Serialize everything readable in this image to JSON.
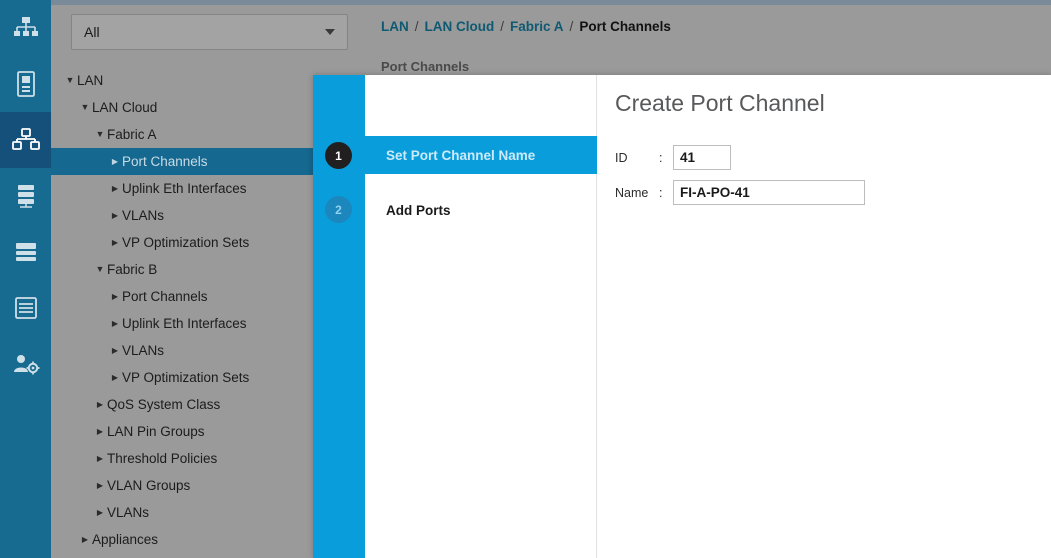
{
  "rail": {
    "items": [
      {
        "name": "equipment-icon",
        "label": "Equipment",
        "active": false
      },
      {
        "name": "servers-icon",
        "label": "Servers",
        "active": false
      },
      {
        "name": "lan-icon",
        "label": "LAN",
        "active": true
      },
      {
        "name": "san-icon",
        "label": "SAN",
        "active": false
      },
      {
        "name": "vm-icon",
        "label": "VM",
        "active": false
      },
      {
        "name": "storage-icon",
        "label": "Storage",
        "active": false
      },
      {
        "name": "admin-icon",
        "label": "Admin",
        "active": false
      }
    ]
  },
  "filter": {
    "value": "All",
    "placeholder": "All"
  },
  "tree": {
    "items": [
      {
        "label": "LAN",
        "indent": 0,
        "twisty": "caret-down",
        "selected": false
      },
      {
        "label": "LAN Cloud",
        "indent": 1,
        "twisty": "caret-down",
        "selected": false
      },
      {
        "label": "Fabric A",
        "indent": 2,
        "twisty": "caret-down",
        "selected": false
      },
      {
        "label": "Port Channels",
        "indent": 3,
        "twisty": "caret-right",
        "selected": true
      },
      {
        "label": "Uplink Eth Interfaces",
        "indent": 3,
        "twisty": "caret-right",
        "selected": false
      },
      {
        "label": "VLANs",
        "indent": 3,
        "twisty": "caret-right",
        "selected": false
      },
      {
        "label": "VP Optimization Sets",
        "indent": 3,
        "twisty": "caret-right",
        "selected": false
      },
      {
        "label": "Fabric B",
        "indent": 2,
        "twisty": "caret-down",
        "selected": false
      },
      {
        "label": "Port Channels",
        "indent": 3,
        "twisty": "caret-right",
        "selected": false
      },
      {
        "label": "Uplink Eth Interfaces",
        "indent": 3,
        "twisty": "caret-right",
        "selected": false
      },
      {
        "label": "VLANs",
        "indent": 3,
        "twisty": "caret-right",
        "selected": false
      },
      {
        "label": "VP Optimization Sets",
        "indent": 3,
        "twisty": "caret-right",
        "selected": false
      },
      {
        "label": "QoS System Class",
        "indent": 2,
        "twisty": "caret-right",
        "selected": false
      },
      {
        "label": "LAN Pin Groups",
        "indent": 2,
        "twisty": "caret-right",
        "selected": false
      },
      {
        "label": "Threshold Policies",
        "indent": 2,
        "twisty": "caret-right",
        "selected": false
      },
      {
        "label": "VLAN Groups",
        "indent": 2,
        "twisty": "caret-right",
        "selected": false
      },
      {
        "label": "VLANs",
        "indent": 2,
        "twisty": "caret-right",
        "selected": false
      },
      {
        "label": "Appliances",
        "indent": 1,
        "twisty": "caret-right",
        "selected": false
      }
    ]
  },
  "breadcrumb": {
    "items": [
      {
        "label": "LAN",
        "current": false
      },
      {
        "label": "LAN Cloud",
        "current": false
      },
      {
        "label": "Fabric A",
        "current": false
      },
      {
        "label": "Port Channels",
        "current": true
      }
    ],
    "separator": "/"
  },
  "content": {
    "subtitle": "Port Channels"
  },
  "dialog": {
    "title": "Create Port Channel",
    "steps": [
      {
        "number": "1",
        "label": "Set Port Channel Name",
        "active": true
      },
      {
        "number": "2",
        "label": "Add Ports",
        "active": false
      }
    ],
    "fields": {
      "id": {
        "label": "ID",
        "colon": ":",
        "value": "41",
        "placeholder": ""
      },
      "name": {
        "label": "Name",
        "colon": ":",
        "value": "FI-A-PO-41",
        "placeholder": ""
      }
    }
  },
  "colors": {
    "rail_bg": "#176b91",
    "rail_active": "#15507a",
    "pane_bg": "#9a9a9a",
    "tree_selected": "#15688f",
    "accent_blue": "#0a9ddb",
    "crumb_link": "#0f5a72",
    "step1_bg": "#221f20",
    "step2_bg": "#1c87bd"
  }
}
